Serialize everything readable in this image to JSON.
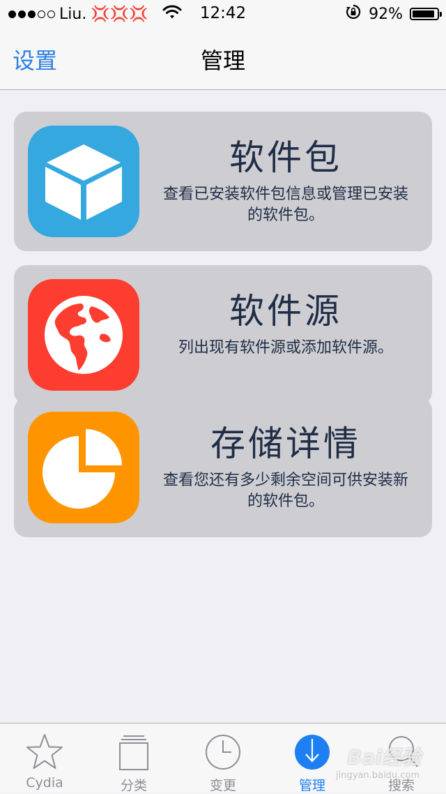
{
  "status_bar": {
    "carrier": "Liu.",
    "carrier_marks": "💢💢💢",
    "time": "12:42",
    "battery": "92%",
    "battery_level": 0.92
  },
  "nav": {
    "back_label": "设置",
    "title": "管理"
  },
  "cards": [
    {
      "title": "软件包",
      "desc": "查看已安装软件包信息或管理已安装的软件包。",
      "icon": "package-cube-icon",
      "color": "#35a8df"
    },
    {
      "title": "软件源",
      "desc": "列出现有软件源或添加软件源。",
      "icon": "globe-icon",
      "color": "#fc3d30"
    },
    {
      "title": "存储详情",
      "desc": "查看您还有多少剩余空间可供安装新的软件包。",
      "icon": "pie-chart-icon",
      "color": "#fe9500"
    }
  ],
  "tabs": [
    {
      "label": "Cydia",
      "icon": "star-icon"
    },
    {
      "label": "分类",
      "icon": "stack-icon"
    },
    {
      "label": "变更",
      "icon": "clock-icon"
    },
    {
      "label": "管理",
      "icon": "download-icon",
      "active": true
    },
    {
      "label": "搜索",
      "icon": "search-icon"
    }
  ],
  "colors": {
    "accent": "#1d7ff2",
    "card_bg": "#ceced2",
    "text_dark": "#1f2d46"
  },
  "watermark": {
    "text": "Bai经验",
    "sub": "jingyan.baidu.com"
  }
}
